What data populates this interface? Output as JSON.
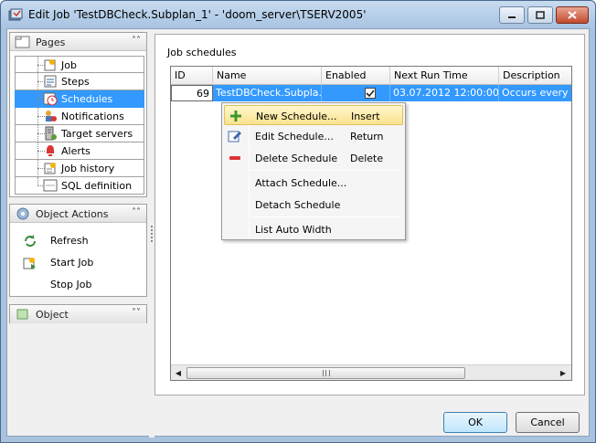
{
  "window": {
    "title": "Edit Job 'TestDBCheck.Subplan_1' - 'doom_server\\TSERV2005'"
  },
  "pages_panel": {
    "title": "Pages",
    "items": [
      {
        "label": "Job",
        "icon": "job-icon"
      },
      {
        "label": "Steps",
        "icon": "steps-icon"
      },
      {
        "label": "Schedules",
        "icon": "schedules-icon",
        "selected": true
      },
      {
        "label": "Notifications",
        "icon": "notifications-icon"
      },
      {
        "label": "Target servers",
        "icon": "target-servers-icon"
      },
      {
        "label": "Alerts",
        "icon": "alerts-icon"
      },
      {
        "label": "Job history",
        "icon": "job-history-icon"
      },
      {
        "label": "SQL definition",
        "icon": "sql-definition-icon"
      }
    ]
  },
  "actions_panel": {
    "title": "Object Actions",
    "items": [
      {
        "label": "Refresh",
        "icon": "refresh-icon"
      },
      {
        "label": "Start Job",
        "icon": "start-job-icon"
      },
      {
        "label": "Stop Job",
        "icon": "stop-job-icon"
      }
    ]
  },
  "object_panel": {
    "title": "Object"
  },
  "main": {
    "group_label": "Job schedules",
    "columns": [
      "ID",
      "Name",
      "Enabled",
      "Next Run Time",
      "Description"
    ],
    "rows": [
      {
        "id": "69",
        "name": "TestDBCheck.Subpla...",
        "enabled": true,
        "next_run": "03.07.2012 12:00:00",
        "description": "Occurs every d"
      }
    ]
  },
  "context_menu": {
    "items": [
      {
        "label": "New Schedule...",
        "shortcut": "Insert",
        "icon": "add-icon"
      },
      {
        "label": "Edit Schedule...",
        "shortcut": "Return",
        "icon": "edit-icon"
      },
      {
        "label": "Delete Schedule",
        "shortcut": "Delete",
        "icon": "delete-icon"
      },
      {
        "label": "Attach Schedule...",
        "shortcut": "",
        "icon": ""
      },
      {
        "label": "Detach Schedule",
        "shortcut": "",
        "icon": ""
      },
      {
        "label": "List Auto Width",
        "shortcut": "",
        "icon": ""
      }
    ]
  },
  "buttons": {
    "ok": "OK",
    "cancel": "Cancel"
  },
  "colors": {
    "selection": "#3399ff",
    "title_bar": "#a9c3df",
    "menu_highlight": "#f9e38d"
  }
}
